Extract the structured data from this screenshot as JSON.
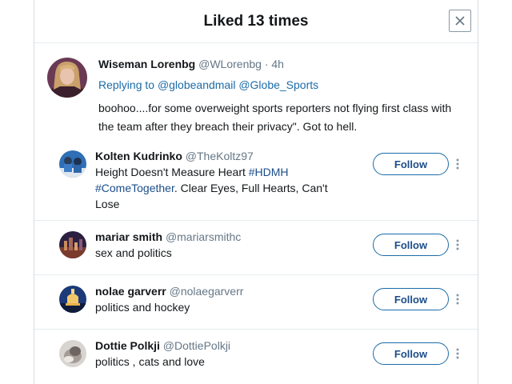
{
  "modal": {
    "title": "Liked 13 times",
    "close_icon": "close-icon"
  },
  "tweet": {
    "name": "Wiseman Lorenbg",
    "handle": "@WLorenbg",
    "time": "· 4h",
    "replying_prefix": "Replying to",
    "replying_to_1": "@globeandmail",
    "replying_to_2": "@Globe_Sports",
    "text": "boohoo....for some overweight sports reporters not flying first class with the team after they breach their privacy\". Got to hell."
  },
  "users": [
    {
      "name": "Kolten Kudrinko",
      "handle": "@TheKoltz97",
      "bio_part1": "Height Doesn't Measure Heart ",
      "bio_tag1": "#HDMH",
      "bio_tag2": "#ComeTogether",
      "bio_part2": ". Clear Eyes, Full Hearts, Can't Lose",
      "follow_label": "Follow"
    },
    {
      "name": "mariar smith",
      "handle": "@mariarsmithc",
      "bio": "sex and politics",
      "follow_label": "Follow"
    },
    {
      "name": "nolae garverr",
      "handle": "@nolaegarverr",
      "bio": "politics and hockey",
      "follow_label": "Follow"
    },
    {
      "name": "Dottie Polkji",
      "handle": "@DottiePolkji",
      "bio": "politics , cats and love",
      "follow_label": "Follow"
    }
  ],
  "colors": {
    "link": "#1b6ca8",
    "text": "#14171a",
    "muted": "#657786",
    "border": "#e6ecf0"
  }
}
